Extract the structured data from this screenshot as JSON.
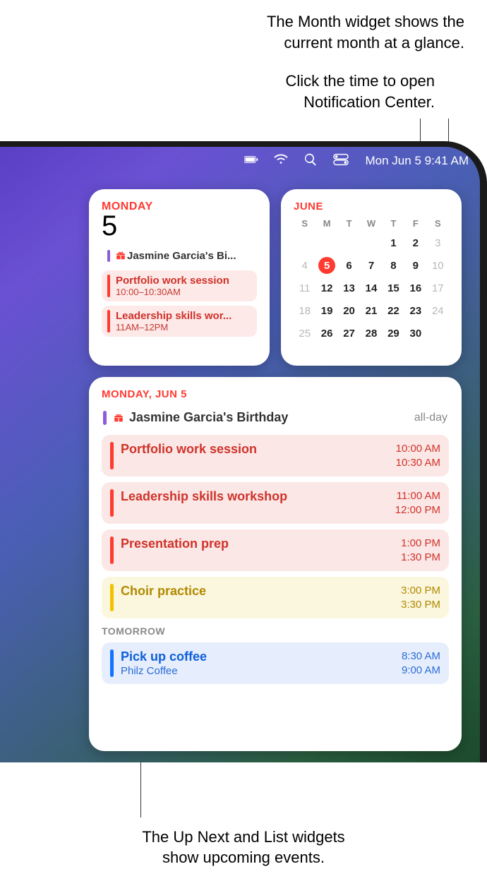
{
  "callouts": {
    "top1": "The Month widget shows the\ncurrent month at a glance.",
    "top2": "Click the time to open\nNotification Center.",
    "bottom": "The Up Next and List widgets\nshow upcoming events."
  },
  "menubar": {
    "datetime": "Mon Jun 5  9:41 AM"
  },
  "upnext": {
    "day": "Monday",
    "date": "5",
    "items": [
      {
        "title": "Jasmine Garcia's Bi...",
        "time": "",
        "bar": "purple",
        "gift": true,
        "bg": ""
      },
      {
        "title": "Portfolio work session",
        "time": "10:00–10:30AM",
        "bar": "red",
        "gift": false,
        "bg": "red"
      },
      {
        "title": "Leadership skills wor...",
        "time": "11AM–12PM",
        "bar": "red",
        "gift": false,
        "bg": "red"
      }
    ]
  },
  "month": {
    "title": "June",
    "dow": [
      "S",
      "M",
      "T",
      "W",
      "T",
      "F",
      "S"
    ],
    "lead_blank": 4,
    "days": [
      1,
      2,
      3,
      4,
      5,
      6,
      7,
      8,
      9,
      10,
      11,
      12,
      13,
      14,
      15,
      16,
      17,
      18,
      19,
      20,
      21,
      22,
      23,
      24,
      25,
      26,
      27,
      28,
      29,
      30
    ],
    "today": 5,
    "weekend_cols": [
      0,
      6
    ]
  },
  "list": {
    "header": "Monday, Jun 5",
    "allday": {
      "title": "Jasmine Garcia's Birthday",
      "tag": "all-day"
    },
    "items": [
      {
        "title": "Portfolio work session",
        "t1": "10:00 AM",
        "t2": "10:30 AM",
        "color": "red"
      },
      {
        "title": "Leadership skills workshop",
        "t1": "11:00 AM",
        "t2": "12:00 PM",
        "color": "red"
      },
      {
        "title": "Presentation prep",
        "t1": "1:00 PM",
        "t2": "1:30 PM",
        "color": "red"
      },
      {
        "title": "Choir practice",
        "t1": "3:00 PM",
        "t2": "3:30 PM",
        "color": "yellow"
      }
    ],
    "tomorrow_label": "Tomorrow",
    "tomorrow": [
      {
        "title": "Pick up coffee",
        "sub": "Philz Coffee",
        "t1": "8:30 AM",
        "t2": "9:00 AM",
        "color": "blue"
      }
    ]
  }
}
